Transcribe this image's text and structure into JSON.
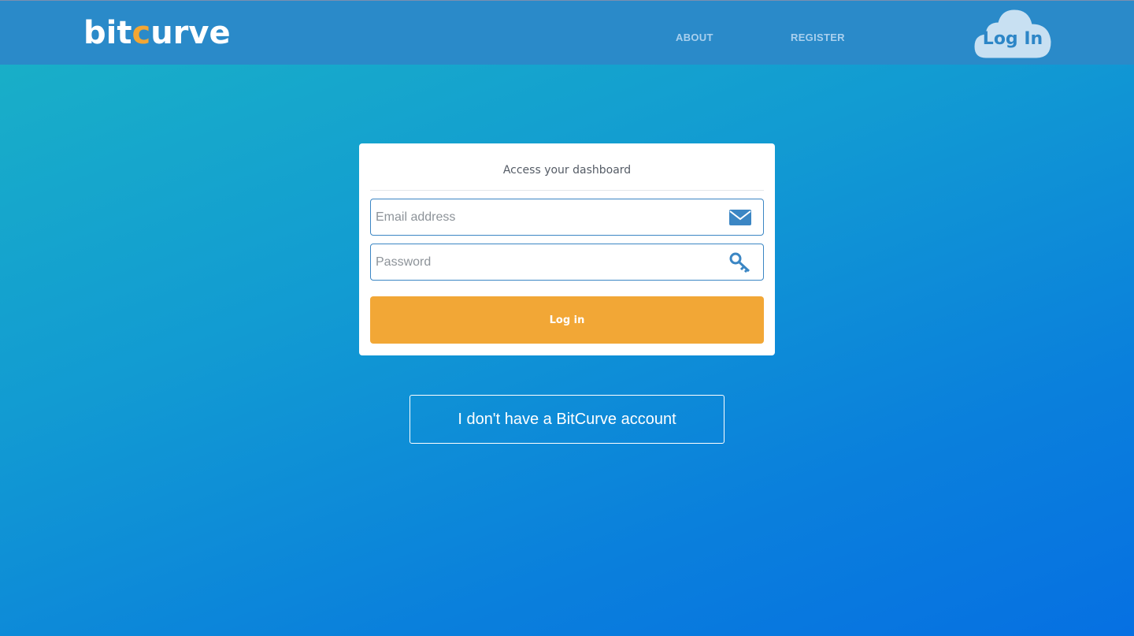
{
  "header": {
    "logo_left": "bit",
    "logo_accent": "c",
    "logo_right": "urve",
    "nav": {
      "about": "ABOUT",
      "register": "REGISTER"
    },
    "login_cloud_label": "Log In"
  },
  "login_card": {
    "title": "Access your dashboard",
    "email_placeholder": "Email address",
    "password_placeholder": "Password",
    "email_icon": "envelope-icon",
    "password_icon": "key-icon",
    "submit_label": "Log in"
  },
  "no_account_label": "I don't have a BitCurve account",
  "colors": {
    "accent": "#f2a736",
    "header": "#2a8ac9",
    "field_border": "#3b86c4"
  }
}
